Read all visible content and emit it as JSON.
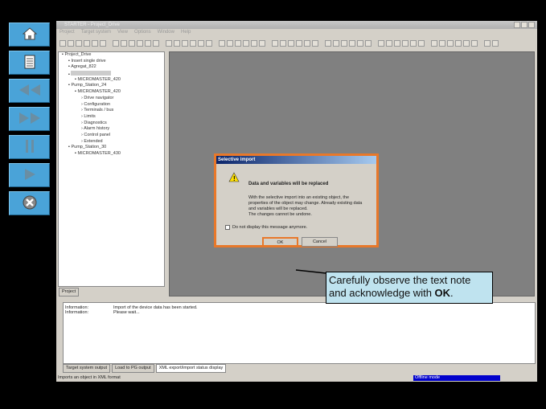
{
  "nav": [
    {
      "name": "home",
      "icon": "home-icon"
    },
    {
      "name": "document",
      "icon": "document-icon"
    },
    {
      "name": "rewind",
      "icon": "rewind-icon"
    },
    {
      "name": "forward",
      "icon": "fast-forward-icon"
    },
    {
      "name": "pause",
      "icon": "pause-icon"
    },
    {
      "name": "play",
      "icon": "play-icon"
    },
    {
      "name": "close",
      "icon": "close-icon"
    }
  ],
  "window": {
    "title": "STARTER - Project_Drive",
    "menu": [
      "Project",
      "Target system",
      "View",
      "Options",
      "Window",
      "Help"
    ]
  },
  "tree": [
    "Project_Drive",
    "Insert single drive",
    "Agregat_822",
    "",
    "MICROMASTER_420",
    "Pump_Station_24",
    "MICROMASTER_420",
    "Drive navigator",
    "Configuration",
    "Terminals / bus",
    "Limits",
    "Diagnostics",
    "Alarm history",
    "Control panel",
    "Extended",
    "Pump_Station_30",
    "MICROMASTER_430"
  ],
  "tree_tab": "Project",
  "dialog": {
    "title": "Selective import",
    "heading": "Data and variables will be replaced",
    "body": [
      "With the selective import into an existing object, the",
      "properties of the object may change. Already existing data",
      "and variables will be replaced.",
      "The changes cannot be undone."
    ],
    "checkbox": "Do not display this message anymore.",
    "checked": false,
    "ok": "OK",
    "cancel": "Cancel"
  },
  "output": {
    "rows": [
      [
        "Information:",
        "Import of the device data has been started."
      ],
      [
        "Information:",
        "Please wait..."
      ]
    ],
    "tabs": [
      "Target system output",
      "Load to PG output",
      "XML export/import status display"
    ]
  },
  "status": {
    "text": "Imports an object in XML format",
    "mode": "Offline mode"
  },
  "callout": {
    "text": "Carefully observe the text note and acknowledge with ",
    "bold": "OK",
    "end": "."
  },
  "colors": {
    "nav": "#4aa3d8",
    "highlight": "#e8782a",
    "callout": "#bfe3ef",
    "offline": "#0000cc"
  }
}
